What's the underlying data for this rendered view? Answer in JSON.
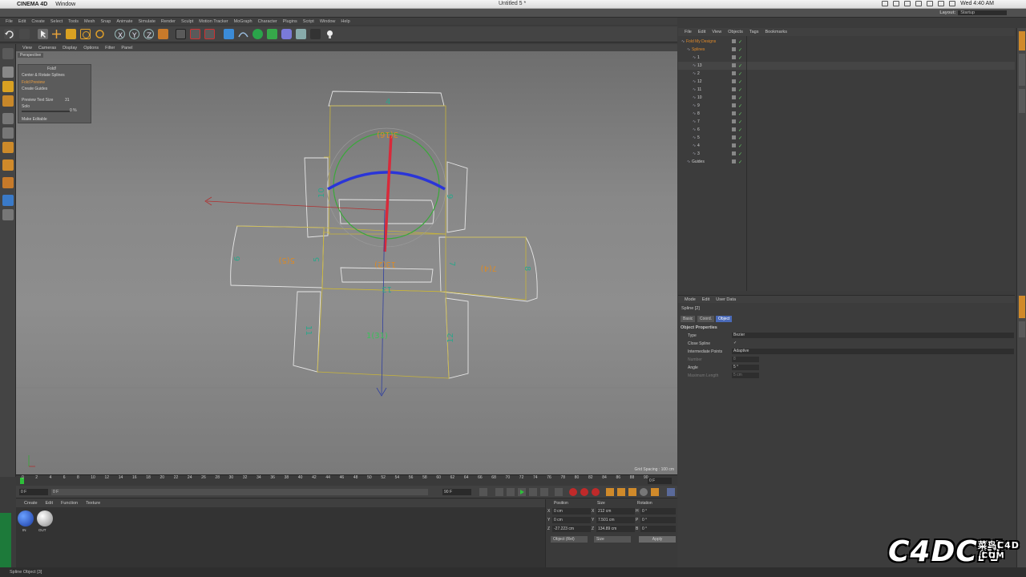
{
  "macbar": {
    "app": "CINEMA 4D",
    "menu": [
      "Window"
    ],
    "doc_title": "Untitled 5 *",
    "clock": "Wed 4:40 AM"
  },
  "layout": {
    "label": "Layout:",
    "value": "Startup"
  },
  "app_menu": [
    "File",
    "Edit",
    "Create",
    "Select",
    "Tools",
    "Mesh",
    "Snap",
    "Animate",
    "Simulate",
    "Render",
    "Sculpt",
    "Motion Tracker",
    "MoGraph",
    "Character",
    "Plugins",
    "Script",
    "Window",
    "Help"
  ],
  "viewport": {
    "menu": [
      "View",
      "Cameras",
      "Display",
      "Options",
      "Filter",
      "Panel"
    ],
    "label": "Perspective",
    "grid_spacing": "Grid Spacing : 100 cm",
    "fold_panel": {
      "title": "Fold!",
      "items": [
        "Center & Rotate Splines",
        "Fold Preview",
        "Create Guides"
      ],
      "preview_text_size_label": "Preview Text Size",
      "preview_text_size_value": "31",
      "solo_label": "Solo",
      "solo_value": "0 %",
      "make_editable": "Make Editable"
    },
    "net_labels": [
      "4",
      "3(16)",
      "10",
      "9",
      "8",
      "5(5)",
      "5",
      "13(2)",
      "7",
      "7(4)",
      "6",
      "11",
      "1(31)",
      "12",
      "13"
    ]
  },
  "timeline": {
    "ticks": [
      "0",
      "2",
      "4",
      "6",
      "8",
      "10",
      "12",
      "14",
      "16",
      "18",
      "20",
      "22",
      "24",
      "26",
      "28",
      "30",
      "32",
      "34",
      "36",
      "38",
      "40",
      "42",
      "44",
      "46",
      "48",
      "50",
      "52",
      "54",
      "56",
      "58",
      "60",
      "62",
      "64",
      "66",
      "68",
      "70",
      "72",
      "74",
      "76",
      "78",
      "80",
      "82",
      "84",
      "86",
      "88",
      "90"
    ],
    "current": "0 F",
    "start": "0 F",
    "start2": "0 F",
    "end": "90 F"
  },
  "material_manager": {
    "menu": [
      "Create",
      "Edit",
      "Function",
      "Texture"
    ],
    "materials": [
      "IN",
      "OUT"
    ]
  },
  "coordinates": {
    "headers": [
      "Position",
      "Size",
      "Rotation"
    ],
    "rows": [
      {
        "ax": "X",
        "pos": "0 cm",
        "sax": "X",
        "size": "212 cm",
        "rax": "H",
        "rot": "0 °"
      },
      {
        "ax": "Y",
        "pos": "0 cm",
        "sax": "Y",
        "size": "7.501 cm",
        "rax": "P",
        "rot": "0 °"
      },
      {
        "ax": "Z",
        "pos": "-27.223 cm",
        "sax": "Z",
        "size": "134.89 cm",
        "rax": "B",
        "rot": "0 °"
      }
    ],
    "mode": "Object (Rel)",
    "size_mode": "Size",
    "apply": "Apply"
  },
  "status": "Spline Object [3]",
  "object_manager": {
    "menu": [
      "File",
      "Edit",
      "View",
      "Objects",
      "Tags",
      "Bookmarks"
    ],
    "rows": [
      {
        "name": "Fold My Designs",
        "indent": 0,
        "color": "#e08a2a"
      },
      {
        "name": "Splines",
        "indent": 1,
        "color": "#e08a2a"
      },
      {
        "name": "1",
        "indent": 2,
        "color": "#cfcfcf"
      },
      {
        "name": "13",
        "indent": 2,
        "color": "#cfcfcf"
      },
      {
        "name": "2",
        "indent": 2,
        "color": "#cfcfcf"
      },
      {
        "name": "12",
        "indent": 2,
        "color": "#cfcfcf"
      },
      {
        "name": "11",
        "indent": 2,
        "color": "#cfcfcf"
      },
      {
        "name": "10",
        "indent": 2,
        "color": "#cfcfcf"
      },
      {
        "name": "9",
        "indent": 2,
        "color": "#cfcfcf"
      },
      {
        "name": "8",
        "indent": 2,
        "color": "#cfcfcf"
      },
      {
        "name": "7",
        "indent": 2,
        "color": "#cfcfcf"
      },
      {
        "name": "6",
        "indent": 2,
        "color": "#cfcfcf"
      },
      {
        "name": "5",
        "indent": 2,
        "color": "#cfcfcf"
      },
      {
        "name": "4",
        "indent": 2,
        "color": "#cfcfcf"
      },
      {
        "name": "3",
        "indent": 2,
        "color": "#cfcfcf"
      },
      {
        "name": "Guides",
        "indent": 1,
        "color": "#cfcfcf"
      }
    ]
  },
  "attribute_manager": {
    "menu": [
      "Mode",
      "Edit",
      "User Data"
    ],
    "object_title": "Spline [2]",
    "tabs": [
      "Basic",
      "Coord.",
      "Object"
    ],
    "section": "Object Properties",
    "props": [
      {
        "label": "Type",
        "value": "Bezier"
      },
      {
        "label": "Close Spline",
        "value": "✓"
      },
      {
        "label": "Intermediate Points",
        "value": "Adaptive"
      },
      {
        "label": "Number",
        "value": "8"
      },
      {
        "label": "Angle",
        "value": "5 °"
      },
      {
        "label": "Maximum Length",
        "value": "5 cm"
      }
    ]
  },
  "watermark": {
    "main": "C4DCN",
    "sub": "菜鸟C4D",
    "com": ".COM"
  }
}
